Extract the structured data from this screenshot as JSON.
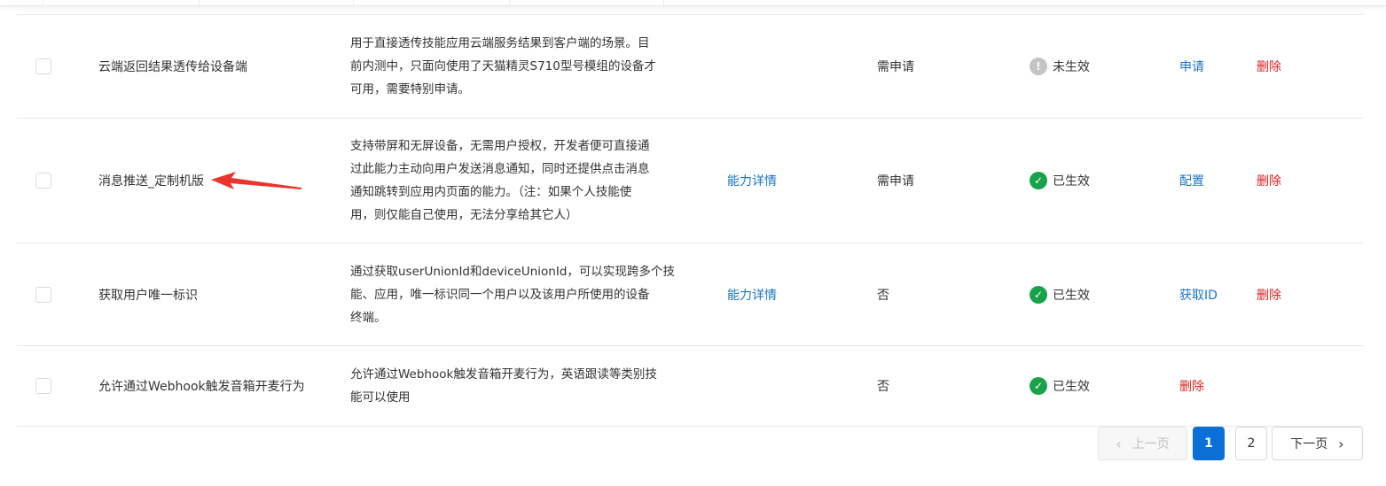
{
  "rows": [
    {
      "name": "云端返回结果透传给设备端",
      "desc": [
        "用于直接透传技能应用云端服务结果到客户端的场景。目",
        "前内测中，只面向使用了天猫精灵S710型号模组的设备才",
        "可用，需要特别申请。"
      ],
      "detail_link": "",
      "need_apply": "需申请",
      "status": "未生效",
      "status_type": "warn",
      "action": "申请",
      "action_type": "link",
      "delete": "删除"
    },
    {
      "name": "消息推送_定制机版",
      "desc": [
        "支持带屏和无屏设备，无需用户授权，开发者便可直接通",
        "过此能力主动向用户发送消息通知，同时还提供点击消息",
        "通知跳转到应用内页面的能力。（注：如果个人技能使",
        "用，则仅能自己使用，无法分享给其它人）"
      ],
      "detail_link": "能力详情",
      "need_apply": "需申请",
      "status": "已生效",
      "status_type": "ok",
      "action": "配置",
      "action_type": "link",
      "delete": "删除"
    },
    {
      "name": "获取用户唯一标识",
      "desc": [
        "通过获取userUnionId和deviceUnionId，可以实现跨多个技",
        "能、应用，唯一标识同一个用户以及该用户所使用的设备",
        "终端。"
      ],
      "detail_link": "能力详情",
      "need_apply": "否",
      "status": "已生效",
      "status_type": "ok",
      "action": "获取ID",
      "action_type": "link",
      "delete": "删除"
    },
    {
      "name": "允许通过Webhook触发音箱开麦行为",
      "desc": [
        "允许通过Webhook触发音箱开麦行为，英语跟读等类别技",
        "能可以使用"
      ],
      "detail_link": "",
      "need_apply": "否",
      "status": "已生效",
      "status_type": "ok",
      "action": "删除",
      "action_type": "danger",
      "delete": ""
    }
  ],
  "pagination": {
    "prev": "上一页",
    "next": "下一页",
    "pages": [
      "1",
      "2"
    ],
    "current": "1"
  },
  "icons": {
    "ok": "check-circle-icon",
    "warn": "exclamation-circle-icon",
    "prev": "chevron-left-icon",
    "next": "chevron-right-icon"
  },
  "colors": {
    "link": "#1a73c8",
    "danger": "#e0201f",
    "ok": "#18a34a",
    "warn": "#c4c4c4",
    "active_page": "#0b6fd8"
  }
}
